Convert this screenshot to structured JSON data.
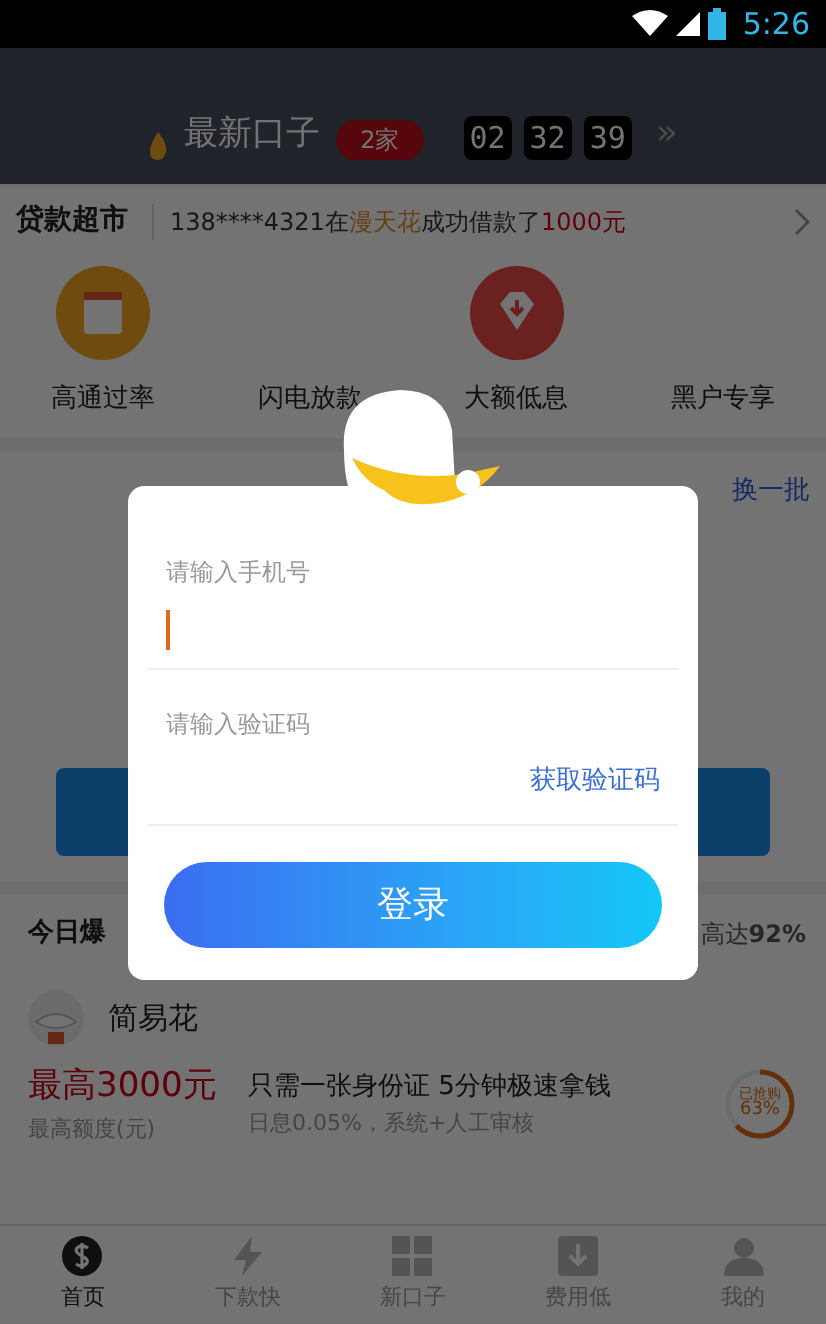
{
  "status_bar": {
    "time": "5:26"
  },
  "header": {
    "title": "最新口子",
    "badge": "2家",
    "countdown": [
      "02",
      "32",
      "39"
    ],
    "more": "»"
  },
  "ticker": {
    "title": "贷款超市",
    "message": [
      {
        "text": "138****4321在",
        "kind": "plain"
      },
      {
        "text": "漫天花",
        "kind": "lender"
      },
      {
        "text": "成功借款了",
        "kind": "plain"
      },
      {
        "text": "1000元",
        "kind": "amount"
      }
    ]
  },
  "shortcuts": [
    {
      "label": "高通过率",
      "kind": "calendar"
    },
    {
      "label": "闪电放款",
      "kind": "none"
    },
    {
      "label": "大额低息",
      "kind": "diamond"
    },
    {
      "label": "黑户专享",
      "kind": "none"
    }
  ],
  "section": {
    "action": "换一批"
  },
  "today": {
    "title": "今日爆",
    "note": "高达**92%**"
  },
  "product": {
    "name": "简易花",
    "amount": "最高3000元",
    "amount_caption": "最高额度(元)",
    "headline": "只需一张身份证 5分钟极速拿钱",
    "detail": "日息0.05%，系统+人工审核",
    "ring_label": "已抢购",
    "ring_value": "63%",
    "level": 0.63
  },
  "tabs": [
    {
      "label": "首页",
      "kind": "dollar",
      "selected": true
    },
    {
      "label": "下款快",
      "kind": "bolt",
      "selected": false
    },
    {
      "label": "新口子",
      "kind": "grid",
      "selected": false
    },
    {
      "label": "费用低",
      "kind": "down",
      "selected": false
    },
    {
      "label": "我的",
      "kind": "person",
      "selected": false
    }
  ],
  "login_dialog": {
    "phone_field": {
      "label": "请输入手机号",
      "focused": true
    },
    "code_field": {
      "label": "请输入验证码"
    },
    "code_link": "获取验证码",
    "submit": "登录"
  }
}
